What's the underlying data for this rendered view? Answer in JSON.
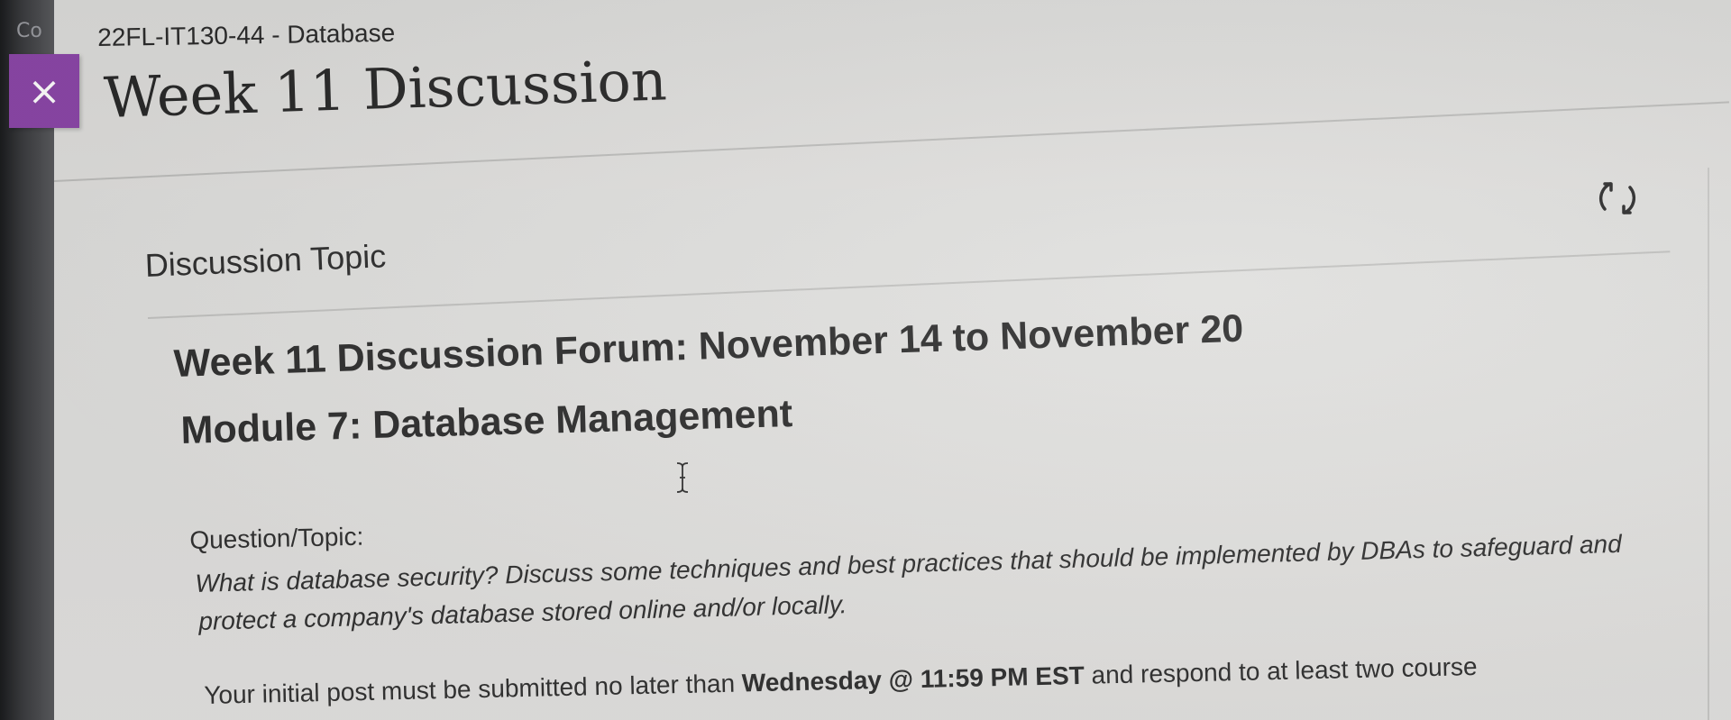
{
  "bezel": {
    "partial_text": "Co"
  },
  "header": {
    "close_icon": "close-icon",
    "close_glyph": "×",
    "course_name": "22FL-IT130-44 - Database",
    "title": "Week 11 Discussion",
    "refresh_icon": "refresh-icon"
  },
  "discussion": {
    "section_label": "Discussion Topic",
    "forum_title": "Week 11 Discussion Forum: November 14 to November 20",
    "module_title": "Module 7: Database Management",
    "question_label": "Question/Topic:",
    "question_line1": "What is database security? Discuss some techniques and best practices that should be implemented by DBAs to safeguard and",
    "question_line2": "protect a company's database stored online and/or locally.",
    "deadline_prefix": "Your initial post must be submitted no later than ",
    "deadline_bold": "Wednesday @ 11:59 PM EST",
    "deadline_suffix": " and respond to at least two course"
  },
  "colors": {
    "accent_purple": "#8c47a8",
    "page_background": "#e1e1df",
    "text_dark": "#303030"
  }
}
